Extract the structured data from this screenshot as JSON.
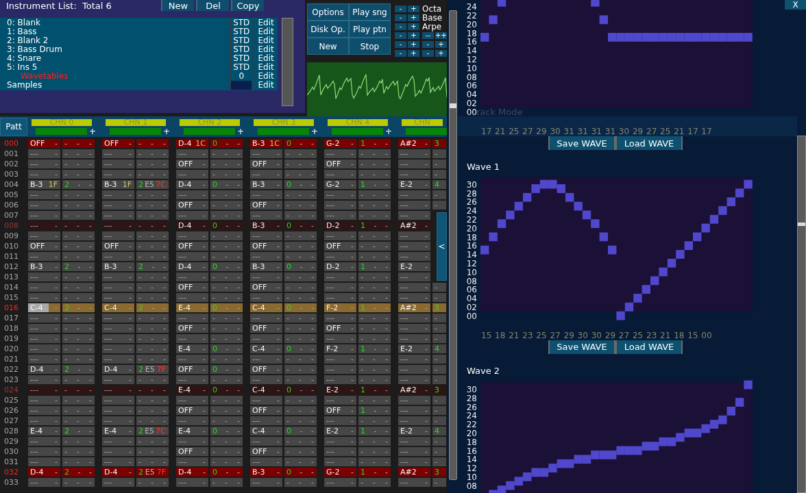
{
  "instrument_panel": {
    "title": "Instrument List:  Total 6",
    "buttons": [
      "New",
      "Del",
      "Copy"
    ],
    "items": [
      {
        "label": "0: Blank",
        "type": "STD",
        "action": "Edit",
        "kind": "instrument"
      },
      {
        "label": "1: Bass",
        "type": "STD",
        "action": "Edit",
        "kind": "instrument"
      },
      {
        "label": "2: Blank 2",
        "type": "STD",
        "action": "Edit",
        "kind": "instrument"
      },
      {
        "label": "3: Bass Drum",
        "type": "STD",
        "action": "Edit",
        "kind": "instrument"
      },
      {
        "label": "4: Snare",
        "type": "STD",
        "action": "Edit",
        "kind": "instrument"
      },
      {
        "label": "5: Ins 5",
        "type": "STD",
        "action": "Edit",
        "kind": "instrument"
      },
      {
        "label": "Wavetables",
        "type": "0",
        "action": "Edit",
        "kind": "wavetable"
      },
      {
        "label": "Samples",
        "action": "Edit",
        "kind": "sample"
      }
    ]
  },
  "transport": [
    "Options",
    "Play sng",
    "Disk Op.",
    "Play ptn",
    "New",
    "Stop"
  ],
  "steppers": [
    {
      "buttons": [
        "-",
        "+"
      ],
      "label": "Octa"
    },
    {
      "buttons": [
        "-",
        "+"
      ],
      "label": "Base"
    },
    {
      "buttons": [
        "-",
        "+"
      ],
      "label": "Arpe"
    },
    {
      "buttons": [
        "-",
        "+",
        "--",
        "++"
      ]
    },
    {
      "buttons": [
        "-",
        "+",
        "-",
        "+"
      ]
    },
    {
      "buttons": [
        "-",
        "+",
        "-",
        "+"
      ]
    }
  ],
  "pattern": {
    "button": "Patt",
    "channels": [
      {
        "label": "CHN 0",
        "plus": "+"
      },
      {
        "label": "CHN 1",
        "plus": "+"
      },
      {
        "label": "CHN 2",
        "plus": "+"
      },
      {
        "label": "CHN 3",
        "plus": "+"
      },
      {
        "label": "CHN 4",
        "plus": "+"
      },
      {
        "label": "CHN"
      }
    ],
    "rows": [
      {
        "num": "000",
        "kind": "bar",
        "cursor": false,
        "cells": [
          [
            {
              "text": "OFF",
              "kind": "note"
            },
            "-",
            "-",
            "-",
            "-"
          ],
          [
            {
              "text": "OFF",
              "kind": "note"
            },
            "-",
            "-",
            "-",
            "-"
          ],
          [
            {
              "text": "D-4",
              "kind": "note"
            },
            {
              "text": "1C",
              "kind": "hex"
            },
            {
              "text": "0",
              "kind": "ins"
            },
            "-",
            "-"
          ],
          [
            {
              "text": "B-3",
              "kind": "note"
            },
            {
              "text": "1C",
              "kind": "hex"
            },
            {
              "text": "0",
              "kind": "ins"
            },
            "-",
            "-"
          ],
          [
            {
              "text": "G-2",
              "kind": "note"
            },
            "-",
            {
              "text": "1",
              "kind": "ins"
            },
            "-",
            "-"
          ],
          [
            {
              "text": "A#2",
              "kind": "note"
            },
            "-",
            {
              "text": "3",
              "kind": "ins"
            }
          ]
        ]
      },
      {
        "num": "001",
        "kind": "normal",
        "cursor": false,
        "cells": [
          [
            "---",
            "-",
            "-",
            "-",
            "-"
          ],
          [
            "---",
            "-",
            "-",
            "-",
            "-"
          ],
          [
            "---",
            "-",
            "-",
            "-",
            "-"
          ],
          [
            "---",
            "-",
            "-",
            "-",
            "-"
          ],
          [
            "---",
            "-",
            "-",
            "-",
            "-"
          ],
          [
            "---",
            "-",
            "-"
          ]
        ]
      },
      {
        "num": "002",
        "kind": "normal",
        "cursor": false,
        "cells": [
          [
            "---",
            "-",
            "-",
            "-",
            "-"
          ],
          [
            "---",
            "-",
            "-",
            "-",
            "-"
          ],
          [
            {
              "text": "OFF",
              "kind": "note"
            },
            "-",
            "-",
            "-",
            "-"
          ],
          [
            {
              "text": "OFF",
              "kind": "note"
            },
            "-",
            "-",
            "-",
            "-"
          ],
          [
            {
              "text": "OFF",
              "kind": "note"
            },
            "-",
            "-",
            "-",
            "-"
          ],
          [
            "---",
            "-",
            "-"
          ]
        ]
      },
      {
        "num": "003",
        "kind": "normal",
        "cursor": false,
        "cells": [
          [
            "---",
            "-",
            "-",
            "-",
            "-"
          ],
          [
            "---",
            "-",
            "-",
            "-",
            "-"
          ],
          [
            "---",
            "-",
            "-",
            "-",
            "-"
          ],
          [
            "---",
            "-",
            "-",
            "-",
            "-"
          ],
          [
            "---",
            "-",
            "-",
            "-",
            "-"
          ],
          [
            "---",
            "-",
            "-"
          ]
        ]
      },
      {
        "num": "004",
        "kind": "normal",
        "cursor": false,
        "cells": [
          [
            {
              "text": "B-3",
              "kind": "note"
            },
            {
              "text": "1F",
              "kind": "hex"
            },
            {
              "text": "2",
              "kind": "ins"
            },
            "-",
            "-"
          ],
          [
            {
              "text": "B-3",
              "kind": "note"
            },
            {
              "text": "1F",
              "kind": "hex"
            },
            {
              "text": "2",
              "kind": "ins"
            },
            {
              "text": "E5",
              "kind": "cmd"
            },
            {
              "text": "7C",
              "kind": "val"
            }
          ],
          [
            {
              "text": "D-4",
              "kind": "note"
            },
            "-",
            {
              "text": "0",
              "kind": "ins"
            },
            "-",
            "-"
          ],
          [
            {
              "text": "B-3",
              "kind": "note"
            },
            "-",
            {
              "text": "0",
              "kind": "ins"
            },
            "-",
            "-"
          ],
          [
            {
              "text": "G-2",
              "kind": "note"
            },
            "-",
            {
              "text": "1",
              "kind": "ins"
            },
            "-",
            "-"
          ],
          [
            {
              "text": "E-2",
              "kind": "note"
            },
            "-",
            {
              "text": "4",
              "kind": "ins"
            }
          ]
        ]
      },
      {
        "num": "005",
        "kind": "normal",
        "cursor": false,
        "cells": [
          [
            "---",
            "-",
            "-",
            "-",
            "-"
          ],
          [
            "---",
            "-",
            "-",
            "-",
            "-"
          ],
          [
            "---",
            "-",
            "-",
            "-",
            "-"
          ],
          [
            "---",
            "-",
            "-",
            "-",
            "-"
          ],
          [
            "---",
            "-",
            "-",
            "-",
            "-"
          ],
          [
            "---",
            "-",
            "-"
          ]
        ]
      },
      {
        "num": "006",
        "kind": "normal",
        "cursor": false,
        "cells": [
          [
            "---",
            "-",
            "-",
            "-",
            "-"
          ],
          [
            "---",
            "-",
            "-",
            "-",
            "-"
          ],
          [
            {
              "text": "OFF",
              "kind": "note"
            },
            "-",
            "-",
            "-",
            "-"
          ],
          [
            {
              "text": "OFF",
              "kind": "note"
            },
            "-",
            "-",
            "-",
            "-"
          ],
          [
            "---",
            "-",
            "-",
            "-",
            "-"
          ],
          [
            "---",
            "-",
            "-"
          ]
        ]
      },
      {
        "num": "007",
        "kind": "normal",
        "cursor": false,
        "cells": [
          [
            "---",
            "-",
            "-",
            "-",
            "-"
          ],
          [
            "---",
            "-",
            "-",
            "-",
            "-"
          ],
          [
            "---",
            "-",
            "-",
            "-",
            "-"
          ],
          [
            "---",
            "-",
            "-",
            "-",
            "-"
          ],
          [
            "---",
            "-",
            "-",
            "-",
            "-"
          ],
          [
            "---",
            "-"
          ]
        ]
      },
      {
        "num": "008",
        "kind": "beat",
        "cursor": false,
        "cells": [
          [
            "---",
            "-",
            "-",
            "-",
            "-"
          ],
          [
            "---",
            "-",
            "-",
            "-",
            "-"
          ],
          [
            {
              "text": "D-4",
              "kind": "note"
            },
            "-",
            {
              "text": "0",
              "kind": "ins"
            },
            "-",
            "-"
          ],
          [
            {
              "text": "B-3",
              "kind": "note"
            },
            "-",
            {
              "text": "0",
              "kind": "ins"
            },
            "-",
            "-"
          ],
          [
            {
              "text": "D-2",
              "kind": "note"
            },
            "-",
            {
              "text": "1",
              "kind": "ins"
            },
            "-",
            "-"
          ],
          [
            {
              "text": "A#2",
              "kind": "note"
            },
            "-"
          ]
        ]
      },
      {
        "num": "009",
        "kind": "normal",
        "cursor": false,
        "cells": [
          [
            "---",
            "-",
            "-",
            "-",
            "-"
          ],
          [
            "---",
            "-",
            "-",
            "-",
            "-"
          ],
          [
            "---",
            "-",
            "-",
            "-",
            "-"
          ],
          [
            "---",
            "-",
            "-",
            "-",
            "-"
          ],
          [
            "---",
            "-",
            "-",
            "-",
            "-"
          ],
          [
            "---",
            "-"
          ]
        ]
      },
      {
        "num": "010",
        "kind": "normal",
        "cursor": false,
        "cells": [
          [
            {
              "text": "OFF",
              "kind": "note"
            },
            "-",
            "-",
            "-",
            "-"
          ],
          [
            {
              "text": "OFF",
              "kind": "note"
            },
            "-",
            "-",
            "-",
            "-"
          ],
          [
            {
              "text": "OFF",
              "kind": "note"
            },
            "-",
            "-",
            "-",
            "-"
          ],
          [
            {
              "text": "OFF",
              "kind": "note"
            },
            "-",
            "-",
            "-",
            "-"
          ],
          [
            {
              "text": "OFF",
              "kind": "note"
            },
            "-",
            "-",
            "-",
            "-"
          ],
          [
            "---",
            "-"
          ]
        ]
      },
      {
        "num": "011",
        "kind": "normal",
        "cursor": false,
        "cells": [
          [
            "---",
            "-",
            "-",
            "-",
            "-"
          ],
          [
            "---",
            "-",
            "-",
            "-",
            "-"
          ],
          [
            "---",
            "-",
            "-",
            "-",
            "-"
          ],
          [
            "---",
            "-",
            "-",
            "-",
            "-"
          ],
          [
            "---",
            "-",
            "-",
            "-",
            "-"
          ],
          [
            "---",
            "-"
          ]
        ]
      },
      {
        "num": "012",
        "kind": "normal",
        "cursor": false,
        "cells": [
          [
            {
              "text": "B-3",
              "kind": "note"
            },
            "-",
            {
              "text": "2",
              "kind": "ins"
            },
            "-",
            "-"
          ],
          [
            {
              "text": "B-3",
              "kind": "note"
            },
            "-",
            {
              "text": "2",
              "kind": "ins"
            },
            "-",
            "-"
          ],
          [
            {
              "text": "D-4",
              "kind": "note"
            },
            "-",
            {
              "text": "0",
              "kind": "ins"
            },
            "-",
            "-"
          ],
          [
            {
              "text": "B-3",
              "kind": "note"
            },
            "-",
            {
              "text": "0",
              "kind": "ins"
            },
            "-",
            "-"
          ],
          [
            {
              "text": "D-2",
              "kind": "note"
            },
            "-",
            {
              "text": "1",
              "kind": "ins"
            },
            "-",
            "-"
          ],
          [
            {
              "text": "E-2",
              "kind": "note"
            },
            "-"
          ]
        ]
      },
      {
        "num": "013",
        "kind": "normal",
        "cursor": false,
        "cells": [
          [
            "---",
            "-",
            "-",
            "-",
            "-"
          ],
          [
            "---",
            "-",
            "-",
            "-",
            "-"
          ],
          [
            "---",
            "-",
            "-",
            "-",
            "-"
          ],
          [
            "---",
            "-",
            "-",
            "-",
            "-"
          ],
          [
            "---",
            "-",
            "-",
            "-",
            "-"
          ],
          [
            "---",
            "-"
          ]
        ]
      },
      {
        "num": "014",
        "kind": "normal",
        "cursor": false,
        "cells": [
          [
            "---",
            "-",
            "-",
            "-",
            "-"
          ],
          [
            "---",
            "-",
            "-",
            "-",
            "-"
          ],
          [
            {
              "text": "OFF",
              "kind": "note"
            },
            "-",
            "-",
            "-",
            "-"
          ],
          [
            {
              "text": "OFF",
              "kind": "note"
            },
            "-",
            "-",
            "-",
            "-"
          ],
          [
            "---",
            "-",
            "-",
            "-",
            "-"
          ],
          [
            "---",
            "-",
            "-"
          ]
        ]
      },
      {
        "num": "015",
        "kind": "normal",
        "cursor": false,
        "cells": [
          [
            "---",
            "-",
            "-",
            "-",
            "-"
          ],
          [
            "---",
            "-",
            "-",
            "-",
            "-"
          ],
          [
            "---",
            "-",
            "-",
            "-",
            "-"
          ],
          [
            "---",
            "-",
            "-",
            "-",
            "-"
          ],
          [
            "---",
            "-",
            "-",
            "-",
            "-"
          ],
          [
            "---",
            "-",
            "-"
          ]
        ]
      },
      {
        "num": "016",
        "kind": "play",
        "cursor": true,
        "cells": [
          [
            {
              "text": "C-4",
              "kind": "note"
            },
            "-",
            {
              "text": "2",
              "kind": "ins"
            },
            "-",
            "-"
          ],
          [
            {
              "text": "C-4",
              "kind": "note"
            },
            "-",
            {
              "text": "2",
              "kind": "ins"
            },
            "-",
            "-"
          ],
          [
            {
              "text": "E-4",
              "kind": "note"
            },
            "-",
            {
              "text": "0",
              "kind": "ins"
            },
            "-",
            "-"
          ],
          [
            {
              "text": "C-4",
              "kind": "note"
            },
            "-",
            {
              "text": "0",
              "kind": "ins"
            },
            "-",
            "-"
          ],
          [
            {
              "text": "F-2",
              "kind": "note"
            },
            "-",
            {
              "text": "1",
              "kind": "ins"
            },
            "-",
            "-"
          ],
          [
            {
              "text": "A#2",
              "kind": "note"
            },
            "-",
            {
              "text": "3",
              "kind": "ins"
            }
          ]
        ]
      },
      {
        "num": "017",
        "kind": "normal",
        "cursor": false,
        "cells": [
          [
            "---",
            "-",
            "-",
            "-",
            "-"
          ],
          [
            "---",
            "-",
            "-",
            "-",
            "-"
          ],
          [
            "---",
            "-",
            "-",
            "-",
            "-"
          ],
          [
            "---",
            "-",
            "-",
            "-",
            "-"
          ],
          [
            "---",
            "-",
            "-",
            "-",
            "-"
          ],
          [
            "---",
            "-",
            "-"
          ]
        ]
      },
      {
        "num": "018",
        "kind": "normal",
        "cursor": false,
        "cells": [
          [
            "---",
            "-",
            "-",
            "-",
            "-"
          ],
          [
            "---",
            "-",
            "-",
            "-",
            "-"
          ],
          [
            {
              "text": "OFF",
              "kind": "note"
            },
            "-",
            "-",
            "-",
            "-"
          ],
          [
            {
              "text": "OFF",
              "kind": "note"
            },
            "-",
            "-",
            "-",
            "-"
          ],
          [
            {
              "text": "OFF",
              "kind": "note"
            },
            "-",
            "-",
            "-",
            "-"
          ],
          [
            "---",
            "-",
            "-"
          ]
        ]
      },
      {
        "num": "019",
        "kind": "normal",
        "cursor": false,
        "cells": [
          [
            "---",
            "-",
            "-",
            "-",
            "-"
          ],
          [
            "---",
            "-",
            "-",
            "-",
            "-"
          ],
          [
            "---",
            "-",
            "-",
            "-",
            "-"
          ],
          [
            "---",
            "-",
            "-",
            "-",
            "-"
          ],
          [
            "---",
            "-",
            "-",
            "-",
            "-"
          ],
          [
            "---",
            "-",
            "-"
          ]
        ]
      },
      {
        "num": "020",
        "kind": "normal",
        "cursor": false,
        "cells": [
          [
            "---",
            "-",
            "-",
            "-",
            "-"
          ],
          [
            "---",
            "-",
            "-",
            "-",
            "-"
          ],
          [
            {
              "text": "E-4",
              "kind": "note"
            },
            "-",
            {
              "text": "0",
              "kind": "ins"
            },
            "-",
            "-"
          ],
          [
            {
              "text": "C-4",
              "kind": "note"
            },
            "-",
            {
              "text": "0",
              "kind": "ins"
            },
            "-",
            "-"
          ],
          [
            {
              "text": "F-2",
              "kind": "note"
            },
            "-",
            {
              "text": "1",
              "kind": "ins"
            },
            "-",
            "-"
          ],
          [
            {
              "text": "E-2",
              "kind": "note"
            },
            "-",
            {
              "text": "4",
              "kind": "ins"
            }
          ]
        ]
      },
      {
        "num": "021",
        "kind": "normal",
        "cursor": false,
        "cells": [
          [
            "---",
            "-",
            "-",
            "-",
            "-"
          ],
          [
            "---",
            "-",
            "-",
            "-",
            "-"
          ],
          [
            "---",
            "-",
            "-",
            "-",
            "-"
          ],
          [
            "---",
            "-",
            "-",
            "-",
            "-"
          ],
          [
            "---",
            "-",
            "-",
            "-",
            "-"
          ],
          [
            "---",
            "-",
            "-"
          ]
        ]
      },
      {
        "num": "022",
        "kind": "normal",
        "cursor": false,
        "cells": [
          [
            {
              "text": "D-4",
              "kind": "note"
            },
            "-",
            {
              "text": "2",
              "kind": "ins"
            },
            "-",
            "-"
          ],
          [
            {
              "text": "D-4",
              "kind": "note"
            },
            "-",
            {
              "text": "2",
              "kind": "ins"
            },
            {
              "text": "E5",
              "kind": "cmd"
            },
            {
              "text": "7F",
              "kind": "val"
            }
          ],
          [
            {
              "text": "OFF",
              "kind": "note"
            },
            "-",
            {
              "text": "0",
              "kind": "ins"
            },
            "-",
            "-"
          ],
          [
            {
              "text": "OFF",
              "kind": "note"
            },
            "-",
            "-",
            "-",
            "-"
          ],
          [
            "---",
            "-",
            "-",
            "-",
            "-"
          ],
          [
            "---",
            "-",
            "-"
          ]
        ]
      },
      {
        "num": "023",
        "kind": "normal",
        "cursor": false,
        "cells": [
          [
            "---",
            "-",
            "-",
            "-",
            "-"
          ],
          [
            "---",
            "-",
            "-",
            "-",
            "-"
          ],
          [
            "---",
            "-",
            "-",
            "-",
            "-"
          ],
          [
            "---",
            "-",
            "-",
            "-",
            "-"
          ],
          [
            "---",
            "-",
            "-",
            "-",
            "-"
          ],
          [
            "---",
            "-",
            "-"
          ]
        ]
      },
      {
        "num": "024",
        "kind": "beat",
        "cursor": false,
        "cells": [
          [
            "---",
            "-",
            "-",
            "-",
            "-"
          ],
          [
            "---",
            "-",
            "-",
            "-",
            "-"
          ],
          [
            {
              "text": "E-4",
              "kind": "note"
            },
            "-",
            {
              "text": "0",
              "kind": "ins"
            },
            "-",
            "-"
          ],
          [
            {
              "text": "C-4",
              "kind": "note"
            },
            "-",
            {
              "text": "0",
              "kind": "ins"
            },
            "-",
            "-"
          ],
          [
            {
              "text": "E-2",
              "kind": "note"
            },
            "-",
            {
              "text": "1",
              "kind": "ins"
            },
            "-",
            "-"
          ],
          [
            {
              "text": "A#2",
              "kind": "note"
            },
            "-",
            {
              "text": "3",
              "kind": "ins"
            }
          ]
        ]
      },
      {
        "num": "025",
        "kind": "normal",
        "cursor": false,
        "cells": [
          [
            "---",
            "-",
            "-",
            "-",
            "-"
          ],
          [
            "---",
            "-",
            "-",
            "-",
            "-"
          ],
          [
            "---",
            "-",
            "-",
            "-",
            "-"
          ],
          [
            "---",
            "-",
            "-",
            "-",
            "-"
          ],
          [
            "---",
            "-",
            "-",
            "-",
            "-"
          ],
          [
            "---",
            "-",
            "-"
          ]
        ]
      },
      {
        "num": "026",
        "kind": "normal",
        "cursor": false,
        "cells": [
          [
            "---",
            "-",
            "-",
            "-",
            "-"
          ],
          [
            "---",
            "-",
            "-",
            "-",
            "-"
          ],
          [
            {
              "text": "OFF",
              "kind": "note"
            },
            "-",
            "-",
            "-",
            "-"
          ],
          [
            {
              "text": "OFF",
              "kind": "note"
            },
            "-",
            "-",
            "-",
            "-"
          ],
          [
            {
              "text": "OFF",
              "kind": "note"
            },
            "-",
            {
              "text": "1",
              "kind": "ins"
            },
            "-",
            "-"
          ],
          [
            "---",
            "-",
            "-"
          ]
        ]
      },
      {
        "num": "027",
        "kind": "normal",
        "cursor": false,
        "cells": [
          [
            "---",
            "-",
            "-",
            "-",
            "-"
          ],
          [
            "---",
            "-",
            "-",
            "-",
            "-"
          ],
          [
            "---",
            "-",
            "-",
            "-",
            "-"
          ],
          [
            "---",
            "-",
            "-",
            "-",
            "-"
          ],
          [
            "---",
            "-",
            "-",
            "-",
            "-"
          ],
          [
            "---",
            "-",
            "-"
          ]
        ]
      },
      {
        "num": "028",
        "kind": "normal",
        "cursor": false,
        "cells": [
          [
            {
              "text": "E-4",
              "kind": "note"
            },
            "-",
            {
              "text": "2",
              "kind": "ins"
            },
            "-",
            "-"
          ],
          [
            {
              "text": "E-4",
              "kind": "note"
            },
            "-",
            {
              "text": "2",
              "kind": "ins"
            },
            {
              "text": "E5",
              "kind": "cmd"
            },
            {
              "text": "7C",
              "kind": "val"
            }
          ],
          [
            {
              "text": "E-4",
              "kind": "note"
            },
            "-",
            {
              "text": "0",
              "kind": "ins"
            },
            "-",
            "-"
          ],
          [
            {
              "text": "C-4",
              "kind": "note"
            },
            "-",
            {
              "text": "0",
              "kind": "ins"
            },
            "-",
            "-"
          ],
          [
            {
              "text": "E-2",
              "kind": "note"
            },
            "-",
            {
              "text": "1",
              "kind": "ins"
            },
            "-",
            "-"
          ],
          [
            {
              "text": "E-2",
              "kind": "note"
            },
            "-",
            {
              "text": "4",
              "kind": "ins"
            }
          ]
        ]
      },
      {
        "num": "029",
        "kind": "normal",
        "cursor": false,
        "cells": [
          [
            "---",
            "-",
            "-",
            "-",
            "-"
          ],
          [
            "---",
            "-",
            "-",
            "-",
            "-"
          ],
          [
            "---",
            "-",
            "-",
            "-",
            "-"
          ],
          [
            "---",
            "-",
            "-",
            "-",
            "-"
          ],
          [
            "---",
            "-",
            "-",
            "-",
            "-"
          ],
          [
            "---",
            "-",
            "-"
          ]
        ]
      },
      {
        "num": "030",
        "kind": "normal",
        "cursor": false,
        "cells": [
          [
            "---",
            "-",
            "-",
            "-",
            "-"
          ],
          [
            "---",
            "-",
            "-",
            "-",
            "-"
          ],
          [
            {
              "text": "OFF",
              "kind": "note"
            },
            "-",
            "-",
            "-",
            "-"
          ],
          [
            {
              "text": "OFF",
              "kind": "note"
            },
            "-",
            "-",
            "-",
            "-"
          ],
          [
            "---",
            "-",
            "-",
            "-",
            "-"
          ],
          [
            "---",
            "-",
            "-"
          ]
        ]
      },
      {
        "num": "031",
        "kind": "normal",
        "cursor": false,
        "cells": [
          [
            "---",
            "-",
            "-",
            "-",
            "-"
          ],
          [
            "---",
            "-",
            "-",
            "-",
            "-"
          ],
          [
            "---",
            "-",
            "-",
            "-",
            "-"
          ],
          [
            "---",
            "-",
            "-",
            "-",
            "-"
          ],
          [
            "---",
            "-",
            "-",
            "-",
            "-"
          ],
          [
            "---",
            "-",
            "-"
          ]
        ]
      },
      {
        "num": "032",
        "kind": "bar",
        "cursor": false,
        "cells": [
          [
            {
              "text": "D-4",
              "kind": "note"
            },
            "-",
            {
              "text": "2",
              "kind": "ins"
            },
            "-",
            "-"
          ],
          [
            {
              "text": "D-4",
              "kind": "note"
            },
            "-",
            {
              "text": "2",
              "kind": "ins"
            },
            {
              "text": "E5",
              "kind": "cmd"
            },
            {
              "text": "7F",
              "kind": "val"
            }
          ],
          [
            {
              "text": "D-4",
              "kind": "note"
            },
            "-",
            {
              "text": "0",
              "kind": "ins"
            },
            "-",
            "-"
          ],
          [
            {
              "text": "B-3",
              "kind": "note"
            },
            "-",
            {
              "text": "0",
              "kind": "ins"
            },
            "-",
            "-"
          ],
          [
            {
              "text": "G-2",
              "kind": "note"
            },
            "-",
            {
              "text": "1",
              "kind": "ins"
            },
            "-",
            "-"
          ],
          [
            {
              "text": "A#2",
              "kind": "note"
            },
            "-",
            {
              "text": "3",
              "kind": "ins"
            }
          ]
        ]
      },
      {
        "num": "033",
        "kind": "normal",
        "cursor": false,
        "cells": [
          [
            "---",
            "-",
            "-",
            "-",
            "-"
          ],
          [
            "---",
            "-",
            "-",
            "-",
            "-"
          ],
          [
            "---",
            "-",
            "-",
            "-",
            "-"
          ],
          [
            "---",
            "-",
            "-",
            "-",
            "-"
          ],
          [
            "---",
            "-",
            "-",
            "-",
            "-"
          ],
          [
            "---",
            "-",
            "-"
          ]
        ]
      }
    ]
  },
  "collapse_tab": "<",
  "wave_editor": {
    "close": "X",
    "ghost_text": "rack Mode",
    "waves": [
      {
        "axis_labels": [
          "24",
          "22",
          "20",
          "18",
          "16",
          "14",
          "12",
          "10",
          "08",
          "06",
          "04",
          "02",
          "00"
        ],
        "readout": "17 21 25 27 29 30 31 31 31 31 30 29 27 25 21 17 17",
        "buttons": [
          "Save WAVE",
          "Load WAVE"
        ]
      },
      {
        "title": "Wave 1",
        "axis_labels": [
          "30",
          "28",
          "26",
          "24",
          "22",
          "20",
          "18",
          "16",
          "14",
          "12",
          "10",
          "08",
          "06",
          "04",
          "02",
          "00"
        ],
        "readout": "15 18 21 23 25 27 29 30 30 29 27 25 23 21 18 15 00",
        "buttons": [
          "Save WAVE",
          "Load WAVE"
        ]
      },
      {
        "title": "Wave 2",
        "axis_labels": [
          "30",
          "28",
          "26",
          "24",
          "22",
          "20",
          "18",
          "16",
          "14",
          "12",
          "10",
          "08"
        ]
      }
    ]
  }
}
